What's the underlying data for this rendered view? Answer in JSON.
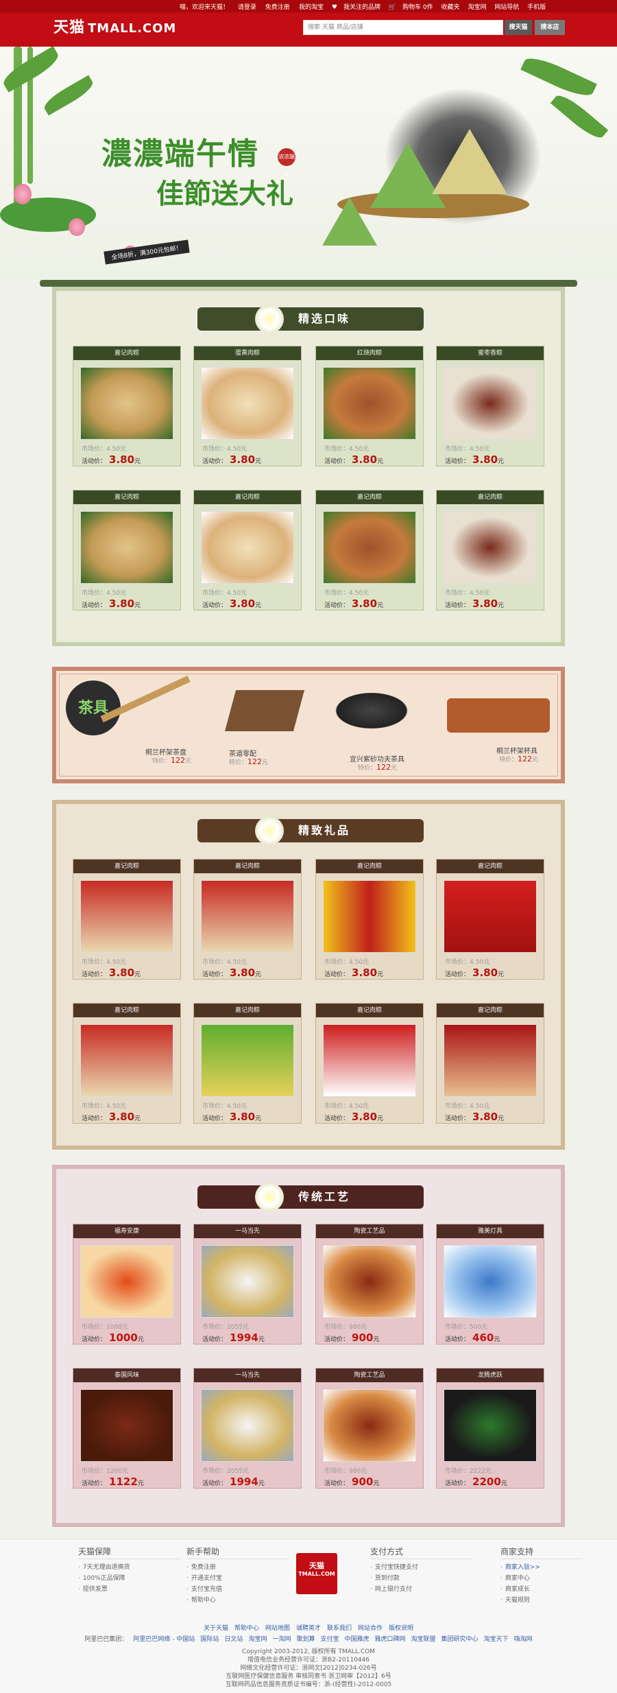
{
  "topbar": {
    "logo": "天猫",
    "logo_en": "TMALL.COM",
    "welcome": "喵，欢迎来天猫！",
    "login": "请登录",
    "register": "免费注册",
    "right_links": [
      "我的淘宝",
      "我关注的品牌",
      "购物车 0件",
      "收藏夹",
      "淘宝网",
      "网站导航",
      "手机版"
    ],
    "search_placeholder": "搜索 天猫 商品/店铺",
    "search_button": "搜天猫",
    "search_shop_button": "搜本店"
  },
  "banner": {
    "line1": "濃濃端午情",
    "line2": "佳節送大礼",
    "seal": "浓浓端午",
    "promo": "全场8折，满300元包邮！"
  },
  "section1": {
    "title": "精选口味",
    "products": [
      {
        "name": "嘉记肉粽",
        "market_label": "市场价：",
        "market_price": "4.50",
        "unit": "元",
        "active_label": "活动价：",
        "price": "3.80",
        "unit2": "元"
      },
      {
        "name": "蛋黄肉粽",
        "market_label": "市场价：",
        "market_price": "4.50",
        "unit": "元",
        "active_label": "活动价：",
        "price": "3.80",
        "unit2": "元"
      },
      {
        "name": "红烧肉粽",
        "market_label": "市场价：",
        "market_price": "4.50",
        "unit": "元",
        "active_label": "活动价：",
        "price": "3.80",
        "unit2": "元"
      },
      {
        "name": "蜜枣香粽",
        "market_label": "市场价：",
        "market_price": "4.50",
        "unit": "元",
        "active_label": "活动价：",
        "price": "3.80",
        "unit2": "元"
      },
      {
        "name": "嘉记肉粽",
        "market_label": "市场价：",
        "market_price": "4.50",
        "unit": "元",
        "active_label": "活动价：",
        "price": "3.80",
        "unit2": "元"
      },
      {
        "name": "嘉记肉粽",
        "market_label": "市场价：",
        "market_price": "4.50",
        "unit": "元",
        "active_label": "活动价：",
        "price": "3.80",
        "unit2": "元"
      },
      {
        "name": "嘉记肉粽",
        "market_label": "市场价：",
        "market_price": "4.50",
        "unit": "元",
        "active_label": "活动价：",
        "price": "3.80",
        "unit2": "元"
      },
      {
        "name": "嘉记肉粽",
        "market_label": "市场价：",
        "market_price": "4.50",
        "unit": "元",
        "active_label": "活动价：",
        "price": "3.80",
        "unit2": "元"
      }
    ]
  },
  "tea": {
    "title": "茶具",
    "items": [
      {
        "name": "桐兰杯架茶盘",
        "price_label": "特价：",
        "price": "122",
        "unit": "元"
      },
      {
        "name": "茶道零配",
        "price_label": "特价：",
        "price": "122",
        "unit": "元"
      },
      {
        "name": "宜兴紫砂功夫茶具",
        "price_label": "特价：",
        "price": "122",
        "unit": "元"
      },
      {
        "name": "桐兰杯架杯具",
        "price_label": "特价：",
        "price": "122",
        "unit": "元"
      }
    ]
  },
  "section3": {
    "title": "精致礼品",
    "products": [
      {
        "name": "嘉记肉粽",
        "market_label": "市场价：",
        "market_price": "4.50",
        "unit": "元",
        "active_label": "活动价：",
        "price": "3.80",
        "unit2": "元"
      },
      {
        "name": "嘉记肉粽",
        "market_label": "市场价：",
        "market_price": "4.50",
        "unit": "元",
        "active_label": "活动价：",
        "price": "3.80",
        "unit2": "元"
      },
      {
        "name": "嘉记肉粽",
        "market_label": "市场价：",
        "market_price": "4.50",
        "unit": "元",
        "active_label": "活动价：",
        "price": "3.80",
        "unit2": "元"
      },
      {
        "name": "嘉记肉粽",
        "market_label": "市场价：",
        "market_price": "4.50",
        "unit": "元",
        "active_label": "活动价：",
        "price": "3.80",
        "unit2": "元"
      },
      {
        "name": "嘉记肉粽",
        "market_label": "市场价：",
        "market_price": "4.50",
        "unit": "元",
        "active_label": "活动价：",
        "price": "3.80",
        "unit2": "元"
      },
      {
        "name": "嘉记肉粽",
        "market_label": "市场价：",
        "market_price": "4.50",
        "unit": "元",
        "active_label": "活动价：",
        "price": "3.80",
        "unit2": "元"
      },
      {
        "name": "嘉记肉粽",
        "market_label": "市场价：",
        "market_price": "4.50",
        "unit": "元",
        "active_label": "活动价：",
        "price": "3.80",
        "unit2": "元"
      },
      {
        "name": "嘉记肉粽",
        "market_label": "市场价：",
        "market_price": "4.50",
        "unit": "元",
        "active_label": "活动价：",
        "price": "3.80",
        "unit2": "元"
      }
    ]
  },
  "section4": {
    "title": "传统工艺",
    "products": [
      {
        "name": "福寿安康",
        "market_label": "市场价：",
        "market_price": "1088",
        "unit": "元",
        "active_label": "活动价：",
        "price": "1000",
        "unit2": "元"
      },
      {
        "name": "一马当先",
        "market_label": "市场价：",
        "market_price": "2055",
        "unit": "元",
        "active_label": "活动价：",
        "price": "1994",
        "unit2": "元"
      },
      {
        "name": "陶瓷工艺品",
        "market_label": "市场价：",
        "market_price": "980",
        "unit": "元",
        "active_label": "活动价：",
        "price": "900",
        "unit2": "元"
      },
      {
        "name": "雅美灯具",
        "market_label": "市场价：",
        "market_price": "500",
        "unit": "元",
        "active_label": "活动价：",
        "price": "460",
        "unit2": "元"
      },
      {
        "name": "泰国风味",
        "market_label": "市场价：",
        "market_price": "1200",
        "unit": "元",
        "active_label": "活动价：",
        "price": "1122",
        "unit2": "元"
      },
      {
        "name": "一马当先",
        "market_label": "市场价：",
        "market_price": "2055",
        "unit": "元",
        "active_label": "活动价：",
        "price": "1994",
        "unit2": "元"
      },
      {
        "name": "陶瓷工艺品",
        "market_label": "市场价：",
        "market_price": "980",
        "unit": "元",
        "active_label": "活动价：",
        "price": "900",
        "unit2": "元"
      },
      {
        "name": "龙腾虎跃",
        "market_label": "市场价：",
        "market_price": "2222",
        "unit": "元",
        "active_label": "活动价：",
        "price": "2200",
        "unit2": "元"
      }
    ]
  },
  "footer": {
    "cols": [
      {
        "title": "天猫保障",
        "items": [
          "7天无理由退换货",
          "100%正品保障",
          "提供发票"
        ]
      },
      {
        "title": "新手帮助",
        "items": [
          "免费注册",
          "开通支付宝",
          "支付宝充值",
          "帮助中心"
        ]
      },
      {
        "title": "支付方式",
        "items": [
          "支付宝快捷支付",
          "货到付款",
          "网上银行支付"
        ]
      },
      {
        "title": "商家支持",
        "items": [
          "商家入驻>>",
          "商家中心",
          "商家成长",
          "天猫规则"
        ]
      }
    ],
    "logo": "天猫",
    "logo_en": "TMALL.COM",
    "links": "关于天猫　帮助中心　网站地图　诚聘英才　联系我们　网站合作　版权说明",
    "group": [
      "阿里巴巴集团：",
      "阿里巴巴网络 - 中国站",
      "国际站",
      "日文站",
      "淘宝网",
      "一淘网",
      "聚划算",
      "支付宝",
      "中国雅虎",
      "雅虎口碑网",
      "淘宝联盟",
      "集团研究中心",
      "淘宝天下",
      "嗨淘网"
    ],
    "copyright": "Copyright 2003-2012, 版权所有 TMALL.COM",
    "license1": "增值电信业务经营许可证：浙B2-20110446",
    "license2": "网络文化经营许可证：浙网文[2012]0234-026号",
    "license3": "互联网医疗保健信息服务 审核同意书 浙卫网审【2012】6号",
    "license4": "互联网药品信息服务资质证书编号：浙-(经营性)-2012-0005"
  }
}
